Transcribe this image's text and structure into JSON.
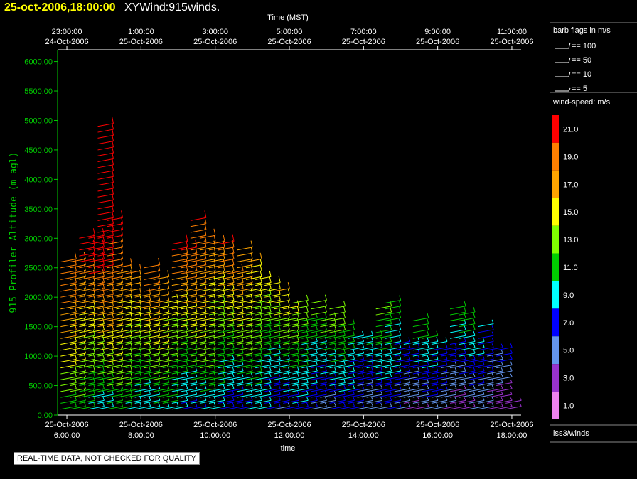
{
  "header": {
    "date": "25-oct-2006,18:00:00",
    "name": "XYWind:915winds."
  },
  "footer": {
    "quality_note": "REAL-TIME DATA, NOT CHECKED FOR QUALITY"
  },
  "chart_data": {
    "type": "wind-barb",
    "top_axis": {
      "label": "Time (MST)",
      "ticks": [
        [
          "23:00:00",
          "24-Oct-2006"
        ],
        [
          "1:00:00",
          "25-Oct-2006"
        ],
        [
          "3:00:00",
          "25-Oct-2006"
        ],
        [
          "5:00:00",
          "25-Oct-2006"
        ],
        [
          "7:00:00",
          "25-Oct-2006"
        ],
        [
          "9:00:00",
          "25-Oct-2006"
        ],
        [
          "11:00:00",
          "25-Oct-2006"
        ]
      ]
    },
    "bottom_axis": {
      "label": "time",
      "ticks": [
        [
          "25-Oct-2006",
          "6:00:00"
        ],
        [
          "25-Oct-2006",
          "8:00:00"
        ],
        [
          "25-Oct-2006",
          "10:00:00"
        ],
        [
          "25-Oct-2006",
          "12:00:00"
        ],
        [
          "25-Oct-2006",
          "14:00:00"
        ],
        [
          "25-Oct-2006",
          "16:00:00"
        ],
        [
          "25-Oct-2006",
          "18:00:00"
        ]
      ],
      "range_hours_utc": [
        5.75,
        18.25
      ]
    },
    "y_axis": {
      "label": "915 Profiler Altitude (m agl)",
      "range": [
        0,
        6200
      ],
      "ticks": [
        "0.00",
        "500.00",
        "1000.00",
        "1500.00",
        "2000.00",
        "2500.00",
        "3000.00",
        "3500.00",
        "4000.00",
        "4500.00",
        "5000.00",
        "5500.00",
        "6000.00"
      ]
    },
    "barb_legend": {
      "title": "barb flags in m/s",
      "entries": [
        "== 100",
        "== 50",
        "== 10",
        "== 5"
      ]
    },
    "color_legend": {
      "title": "wind-speed: m/s",
      "bins": [
        {
          "label": "21.0",
          "color": "#ff0000"
        },
        {
          "label": "19.0",
          "color": "#ff7f00"
        },
        {
          "label": "17.0",
          "color": "#ffa500"
        },
        {
          "label": "15.0",
          "color": "#ffff00"
        },
        {
          "label": "13.0",
          "color": "#7fff00"
        },
        {
          "label": "11.0",
          "color": "#00cc00"
        },
        {
          "label": "9.0",
          "color": "#00ffff"
        },
        {
          "label": "7.0",
          "color": "#0000ff"
        },
        {
          "label": "5.0",
          "color": "#6495ed"
        },
        {
          "label": "3.0",
          "color": "#9932cc"
        },
        {
          "label": "1.0",
          "color": "#ee82ee"
        }
      ]
    },
    "source": "iss3/winds",
    "profile_times_h": [
      5.833,
      6.083,
      6.333,
      6.583,
      6.833,
      7.083,
      7.333,
      7.583,
      7.833,
      8.083,
      8.333,
      8.583,
      8.833,
      9.083,
      9.333,
      9.583,
      9.833,
      10.083,
      10.333,
      10.583,
      10.833,
      11.083,
      11.333,
      11.583,
      11.833,
      12.083,
      12.333,
      12.583,
      12.833,
      13.083,
      13.333,
      13.583,
      13.833,
      14.083,
      14.333,
      14.583,
      14.833,
      15.083,
      15.333,
      15.583,
      15.833,
      16.083,
      16.333,
      16.583,
      16.833,
      17.083,
      17.333,
      17.583,
      17.833
    ],
    "profile_tops_m": [
      2600,
      2650,
      3050,
      3050,
      4900,
      3350,
      2550,
      2400,
      2000,
      2500,
      2300,
      1950,
      2900,
      2800,
      3300,
      3000,
      2900,
      2900,
      2400,
      2800,
      2650,
      2350,
      2200,
      2150,
      1800,
      1950,
      1600,
      1900,
      1600,
      1800,
      1500,
      1300,
      1300,
      1300,
      1850,
      1900,
      1250,
      1200,
      1600,
      1300,
      1250,
      1150,
      1800,
      1700,
      1250,
      1550,
      1150,
      1100,
      250
    ]
  }
}
